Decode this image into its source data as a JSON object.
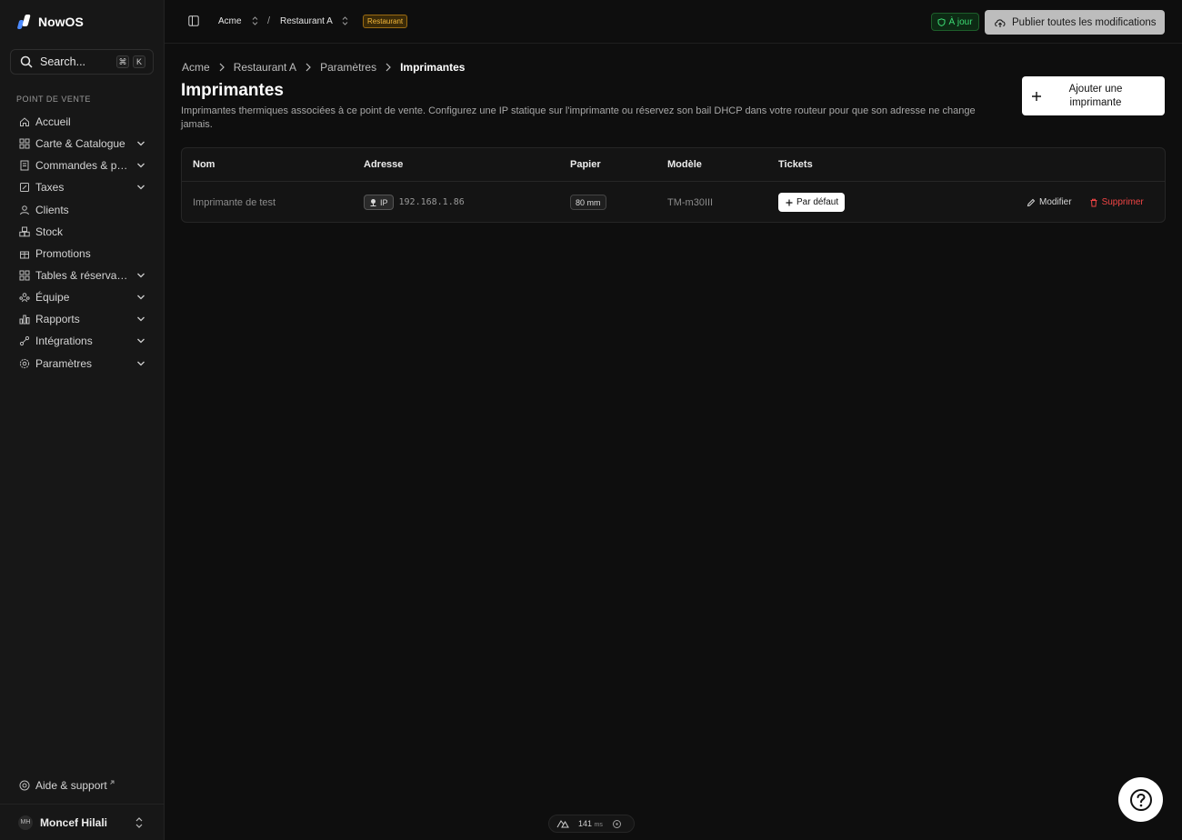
{
  "app": {
    "name": "NowOS"
  },
  "search": {
    "placeholder": "Search...",
    "shortcut_mod": "⌘",
    "shortcut_key": "K"
  },
  "sidebar": {
    "section_label": "POINT DE VENTE",
    "items": [
      {
        "label": "Accueil",
        "icon": "home-icon",
        "expandable": false
      },
      {
        "label": "Carte & Catalogue",
        "icon": "grid-icon",
        "expandable": true
      },
      {
        "label": "Commandes & paiements",
        "icon": "receipt-icon",
        "expandable": true
      },
      {
        "label": "Taxes",
        "icon": "percent-icon",
        "expandable": true
      },
      {
        "label": "Clients",
        "icon": "users-icon",
        "expandable": false
      },
      {
        "label": "Stock",
        "icon": "boxes-icon",
        "expandable": false
      },
      {
        "label": "Promotions",
        "icon": "gift-icon",
        "expandable": false
      },
      {
        "label": "Tables & réservations",
        "icon": "layout-icon",
        "expandable": true
      },
      {
        "label": "Équipe",
        "icon": "team-icon",
        "expandable": true
      },
      {
        "label": "Rapports",
        "icon": "bar-chart-icon",
        "expandable": true
      },
      {
        "label": "Intégrations",
        "icon": "plug-icon",
        "expandable": true
      },
      {
        "label": "Paramètres",
        "icon": "gear-icon",
        "expandable": true
      }
    ],
    "help_label": "Aide & support",
    "user": {
      "initials": "MH",
      "name": "Moncef Hilali"
    }
  },
  "topbar": {
    "org": "Acme",
    "separator": "/",
    "restaurant": "Restaurant A",
    "badge": "Restaurant",
    "status": "À jour",
    "publish_label": "Publier toutes les modifications"
  },
  "breadcrumb": [
    "Acme",
    "Restaurant A",
    "Paramètres",
    "Imprimantes"
  ],
  "page": {
    "title": "Imprimantes",
    "description": "Imprimantes thermiques associées à ce point de vente. Configurez une IP statique sur l'imprimante ou réservez son bail DHCP dans votre routeur pour que son adresse ne change jamais.",
    "add_button": "Ajouter une imprimante"
  },
  "table": {
    "columns": [
      "Nom",
      "Adresse",
      "Papier",
      "Modèle",
      "Tickets"
    ],
    "rows": [
      {
        "name": "Imprimante de test",
        "address_type": "IP",
        "address": "192.168.1.86",
        "paper": "80 mm",
        "model": "TM-m30III",
        "ticket_button": "Par défaut",
        "edit_label": "Modifier",
        "delete_label": "Supprimer"
      }
    ]
  },
  "perf": {
    "value": "141",
    "unit": "ms"
  },
  "colors": {
    "accent_warning": "#f4b73a",
    "status_ok": "#3ddc74",
    "danger": "#ef4444"
  }
}
